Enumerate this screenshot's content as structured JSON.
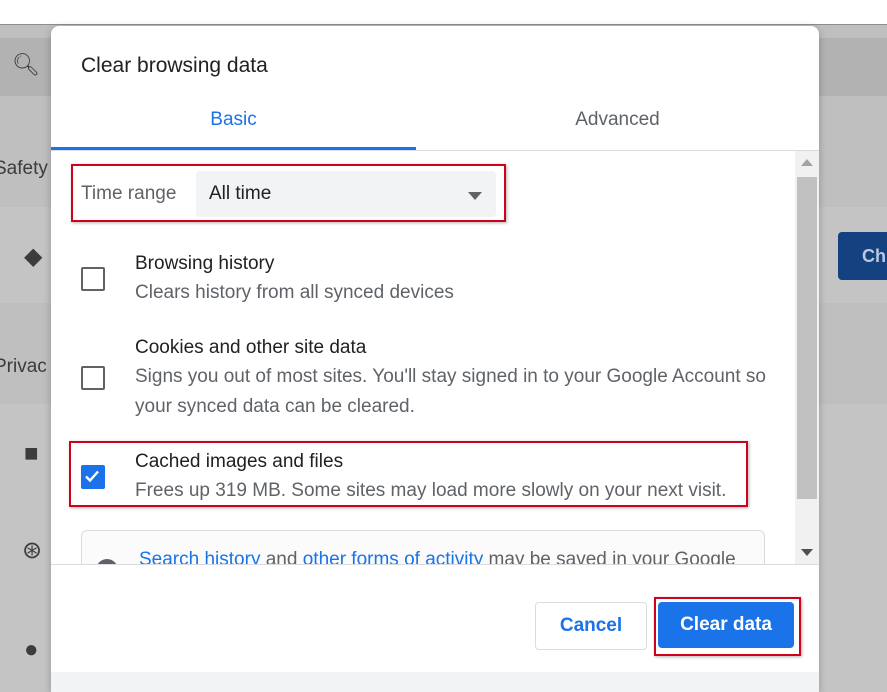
{
  "background": {
    "safety_label": "Safety",
    "privacy_label": "Privac",
    "check_button_label": "Ch"
  },
  "dialog": {
    "title": "Clear browsing data",
    "tabs": [
      {
        "label": "Basic",
        "selected": true
      },
      {
        "label": "Advanced",
        "selected": false
      }
    ],
    "time_range": {
      "label": "Time range",
      "value": "All time"
    },
    "options": [
      {
        "title": "Browsing history",
        "description": "Clears history from all synced devices",
        "checked": false
      },
      {
        "title": "Cookies and other site data",
        "description": "Signs you out of most sites. You'll stay signed in to your Google Account so your synced data can be cleared.",
        "checked": false
      },
      {
        "title": "Cached images and files",
        "description": "Frees up 319 MB. Some sites may load more slowly on your next visit.",
        "checked": true
      }
    ],
    "info": {
      "link1": "Search history",
      "text1": " and ",
      "link2": "other forms of activity",
      "text2": " may be saved in your Google"
    },
    "buttons": {
      "cancel": "Cancel",
      "clear": "Clear data"
    }
  },
  "colors": {
    "accent": "#1a73e8",
    "highlight": "#d0021b"
  }
}
